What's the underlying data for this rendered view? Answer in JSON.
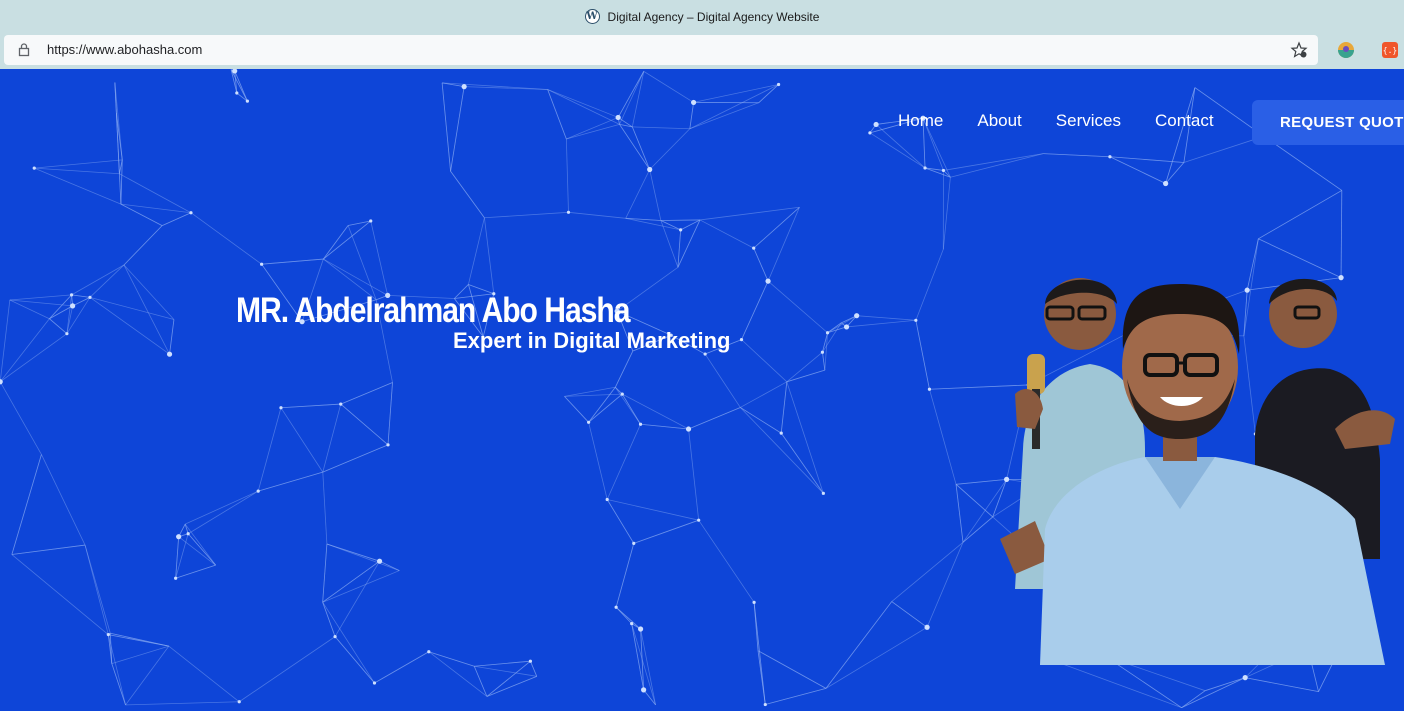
{
  "browser": {
    "tab_title": "Digital Agency – Digital Agency Website",
    "url": "https://www.abohasha.com"
  },
  "nav": {
    "items": [
      "Home",
      "About",
      "Services",
      "Contact"
    ],
    "cta": "REQUEST QUOTE"
  },
  "hero": {
    "name": "MR. Abdelrahman Abo Hasha",
    "subtitle": "Expert in Digital Marketing"
  },
  "colors": {
    "background": "#0e45d8",
    "chrome": "#c9dfe2",
    "cta": "#2a5fe6"
  }
}
